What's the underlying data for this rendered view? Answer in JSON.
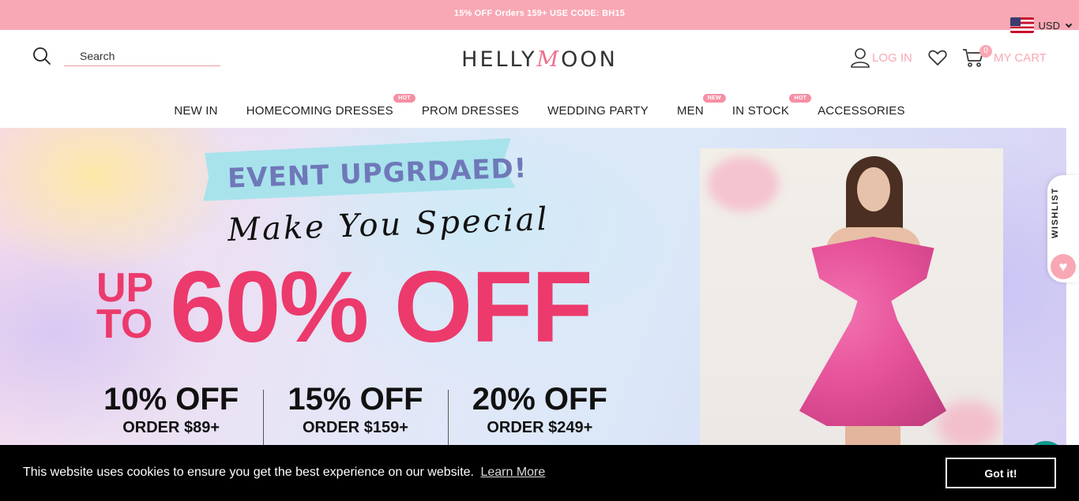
{
  "topbar": {
    "promo": "15% OFF Orders 159+ USE CODE: BH15",
    "currency": "USD"
  },
  "header": {
    "search_placeholder": "Search",
    "logo_left": "HELLY",
    "logo_m": "M",
    "logo_right": "OON",
    "login_label": "LOG IN",
    "cart_count": "0",
    "cart_label": "MY CART"
  },
  "nav": [
    {
      "label": "NEW IN",
      "badge": ""
    },
    {
      "label": "HOMECOMING DRESSES",
      "badge": "HOT"
    },
    {
      "label": "PROM DRESSES",
      "badge": ""
    },
    {
      "label": "WEDDING PARTY",
      "badge": ""
    },
    {
      "label": "MEN",
      "badge": "NEW"
    },
    {
      "label": "IN STOCK",
      "badge": "HOT"
    },
    {
      "label": "ACCESSORIES",
      "badge": ""
    }
  ],
  "banner": {
    "event": "EVENT UPGRDAED!",
    "script": "Make You Special",
    "up": "UP",
    "to": "TO",
    "discount": "60% OFF",
    "tiers": [
      {
        "pct": "10% OFF",
        "order": "ORDER $89+"
      },
      {
        "pct": "15% OFF",
        "order": "ORDER $159+"
      },
      {
        "pct": "20% OFF",
        "order": "ORDER $249+"
      }
    ]
  },
  "wishlist_tab": "WISHLIST",
  "cookie": {
    "message": "This website uses cookies to ensure you get the best experience on our website.",
    "learn_more": "Learn More",
    "accept": "Got it!"
  },
  "colors": {
    "brand_pink": "#f8a8b4",
    "accent": "#ec3a6c",
    "cookie_bg": "#000000"
  }
}
